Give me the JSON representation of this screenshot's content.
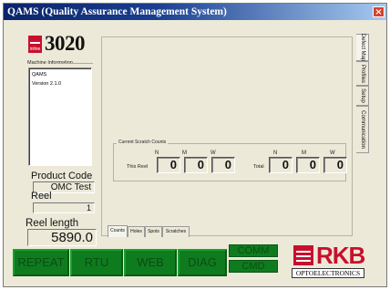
{
  "window": {
    "title": "QAMS (Quality Assurance Management System)",
    "close_glyph": "×"
  },
  "logo": {
    "text": "3020",
    "mark_text": "inline"
  },
  "machine_info": {
    "label": "Machine Information",
    "lines": [
      "QAMS",
      "Version 2.1.0"
    ]
  },
  "product_code": {
    "label": "Product Code",
    "value": "OMC Test"
  },
  "reel": {
    "label": "Reel",
    "value": "1"
  },
  "reel_length": {
    "label": "Reel length",
    "value": "5890.0"
  },
  "scratch_counts": {
    "title": "Current Scratch Counts",
    "headers": [
      "N",
      "M",
      "W"
    ],
    "this_reel": {
      "label": "This Reel",
      "values": [
        "0",
        "0",
        "0"
      ]
    },
    "total": {
      "label": "Total",
      "values": [
        "0",
        "0",
        "0"
      ]
    }
  },
  "bottom_tabs": [
    "Counts",
    "Holes",
    "Spots",
    "Scratches"
  ],
  "side_tabs": [
    "Defect Map",
    "Profiles",
    "Setup",
    "Communication"
  ],
  "buttons": {
    "repeat": "REPEAT",
    "rtu": "RTU",
    "web": "WEB",
    "diag": "DIAG",
    "comm": "COMM",
    "cmd": "CMD"
  },
  "brand": {
    "name": "RKB",
    "sub": "OPTOELECTRONICS"
  },
  "colors": {
    "indicator_green": "#0f7b1f",
    "brand_red": "#c8102e",
    "title_blue": "#0a246a"
  }
}
